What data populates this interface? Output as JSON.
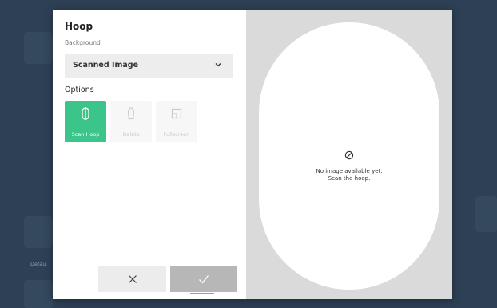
{
  "dialog": {
    "title": "Hoop",
    "background_label": "Background",
    "background_select": {
      "value": "Scanned Image"
    },
    "options_label": "Options",
    "options": [
      {
        "label": "Scan Hoop",
        "icon": "scan-hoop-icon",
        "state": "active"
      },
      {
        "label": "Delete",
        "icon": "trash-icon",
        "state": "disabled"
      },
      {
        "label": "Fullscreen",
        "icon": "fullscreen-icon",
        "state": "disabled"
      }
    ],
    "buttons": {
      "cancel_icon": "close-icon",
      "confirm_icon": "checkmark-icon"
    },
    "preview": {
      "message_line1": "No image available yet.",
      "message_line2": "Scan the hoop.",
      "icon": "no-image-icon"
    }
  },
  "background_app": {
    "partial_label": "Defau"
  },
  "colors": {
    "accent": "#3cc58a",
    "backdrop": "#2e4055",
    "preview_bg": "#dadada"
  }
}
